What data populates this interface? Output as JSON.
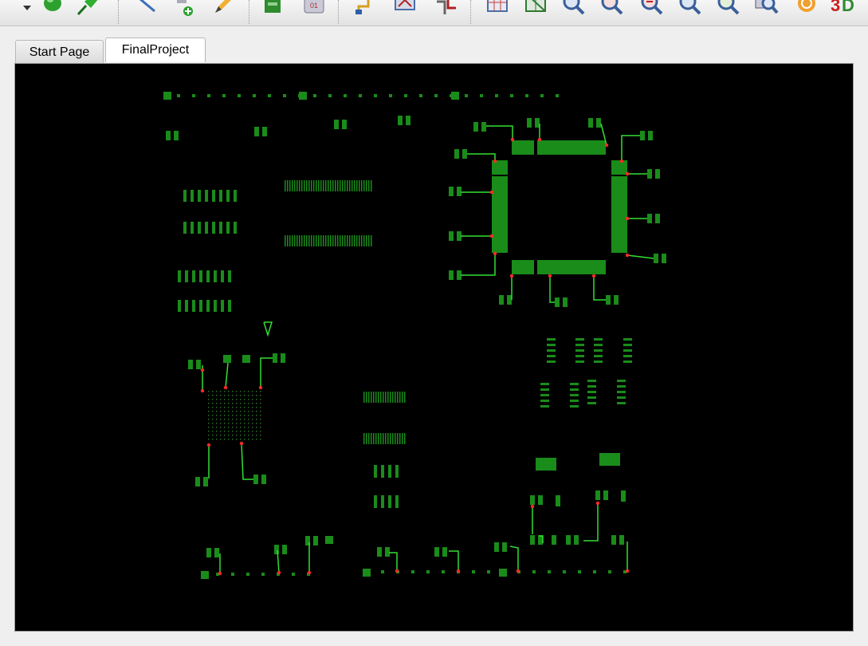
{
  "toolbar": {
    "buttons": [
      {
        "icon": "dropdown-arrow-icon"
      },
      {
        "icon": "green-component-icon"
      },
      {
        "icon": "pin-icon"
      },
      {
        "icon": "line-tool-icon"
      },
      {
        "icon": "add-component-icon"
      },
      {
        "icon": "pencil-icon"
      },
      {
        "icon": "copy-sheet-icon"
      },
      {
        "icon": "layer-icon"
      },
      {
        "icon": "route-trace-icon"
      },
      {
        "icon": "place-footprint-icon"
      },
      {
        "icon": "via-icon"
      },
      {
        "icon": "grid-icon"
      },
      {
        "icon": "board-grid-icon"
      },
      {
        "icon": "zoom-fit-icon"
      },
      {
        "icon": "zoom-in-icon"
      },
      {
        "icon": "zoom-out-icon"
      },
      {
        "icon": "zoom-area-icon"
      },
      {
        "icon": "zoom-selection-icon"
      },
      {
        "icon": "zoom-board-icon"
      },
      {
        "icon": "refresh-icon"
      },
      {
        "icon": "3d-view-icon"
      }
    ]
  },
  "tabs": [
    {
      "label": "Start Page",
      "active": false
    },
    {
      "label": "FinalProject",
      "active": true
    }
  ],
  "colors": {
    "canvas_background": "#000000",
    "pad": "#1a8c1a",
    "trace": "#33dd33",
    "marker": "#ff2a2a"
  }
}
